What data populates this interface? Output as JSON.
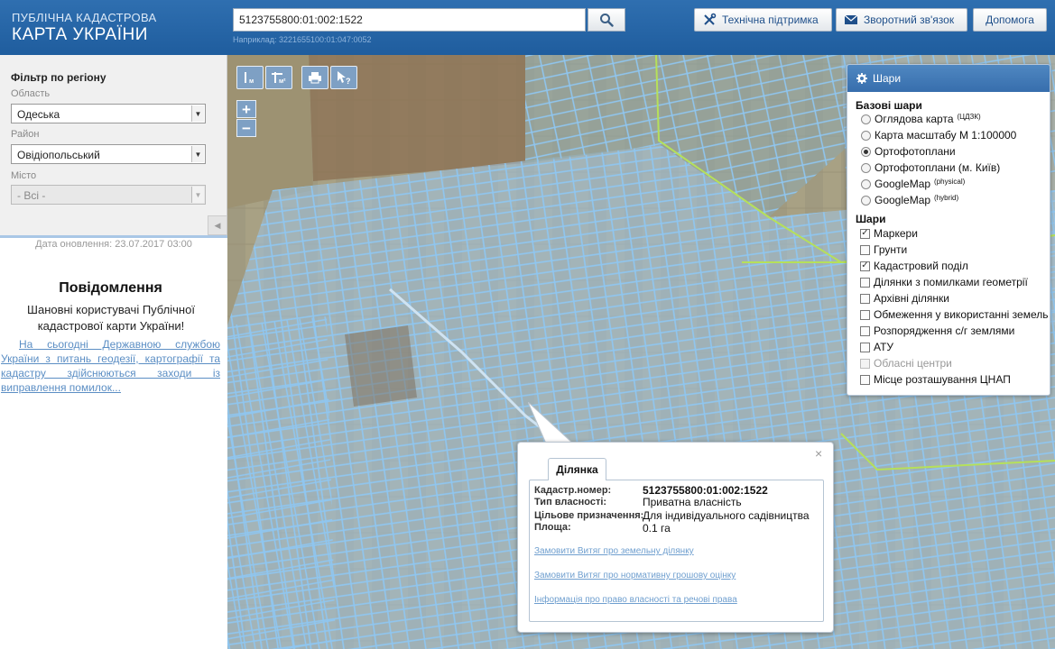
{
  "header": {
    "logo_line1": "ПУБЛІЧНА КАДАСТРОВА",
    "logo_line2": "КАРТА УКРАЇНИ",
    "search_value": "5123755800:01:002:1522",
    "search_hint": "Наприклад: 3221655100:01:047:0052",
    "btn_support": "Технічна підтримка",
    "btn_feedback": "Зворотний зв'язок",
    "btn_help": "Допомога"
  },
  "sidebar": {
    "filter_title": "Фільтр по регіону",
    "oblast_label": "Область",
    "oblast_value": "Одеська",
    "raion_label": "Район",
    "raion_value": "Овідіопольський",
    "misto_label": "Місто",
    "misto_value": "- Всі -",
    "updated": "Дата оновлення: 23.07.2017 03:00",
    "message_title": "Повідомлення",
    "message_text": "Шановні користувачі Публічної кадастрової карти України!",
    "message_link": "На сьогодні Державною службою України з питань геодезії, картографії та кадастру здійснюються заходи із виправлення помилок..."
  },
  "map_tools": {
    "ruler_sub": "м",
    "area_sub": "м²",
    "zoom_in": "+",
    "zoom_out": "−"
  },
  "layers": {
    "title": "Шари",
    "base_title": "Базові шари",
    "base": [
      {
        "label": "Оглядова карта",
        "sup": "(ЦДЗК)",
        "selected": false
      },
      {
        "label": "Карта масштабу М 1:100000",
        "sup": "",
        "selected": false
      },
      {
        "label": "Ортофотоплани",
        "sup": "",
        "selected": true
      },
      {
        "label": "Ортофотоплани (м. Київ)",
        "sup": "",
        "selected": false
      },
      {
        "label": "GoogleMap",
        "sup": "(physical)",
        "selected": false
      },
      {
        "label": "GoogleMap",
        "sup": "(hybrid)",
        "selected": false
      }
    ],
    "overlay_title": "Шари",
    "overlays": [
      {
        "label": "Маркери",
        "checked": true,
        "disabled": false
      },
      {
        "label": "Грунти",
        "checked": false,
        "disabled": false
      },
      {
        "label": "Кадастровий поділ",
        "checked": true,
        "disabled": false
      },
      {
        "label": "Ділянки з помилками геометрії",
        "checked": false,
        "disabled": false
      },
      {
        "label": "Архівні ділянки",
        "checked": false,
        "disabled": false
      },
      {
        "label": "Обмеження у використанні земель",
        "checked": false,
        "disabled": false
      },
      {
        "label": "Розпорядження с/г землями",
        "checked": false,
        "disabled": false
      },
      {
        "label": "АТУ",
        "checked": false,
        "disabled": false
      },
      {
        "label": "Обласні центри",
        "checked": false,
        "disabled": true
      },
      {
        "label": "Місце розташування ЦНАП",
        "checked": false,
        "disabled": false
      }
    ]
  },
  "popup": {
    "tab": "Ділянка",
    "close": "×",
    "rows": [
      {
        "key": "Кадастр.номер:",
        "value": "5123755800:01:002:1522"
      },
      {
        "key": "Тип власності:",
        "value": "Приватна власність"
      },
      {
        "key": "Цільове призначення:",
        "value": "Для індивідуального садівництва"
      },
      {
        "key": "Площа:",
        "value": "0.1 га"
      }
    ],
    "links": [
      "Замовити Витяг про земельну ділянку",
      "Замовити Витяг про нормативну грошову оцінку",
      "Інформація про право власності та речові права"
    ]
  },
  "colors": {
    "header": "#2a68a8",
    "parcel_line": "#8fc6f0",
    "parcel_fill": "#9fc4e4",
    "boundary": "#b6e05a",
    "link": "#6f9fcf"
  }
}
